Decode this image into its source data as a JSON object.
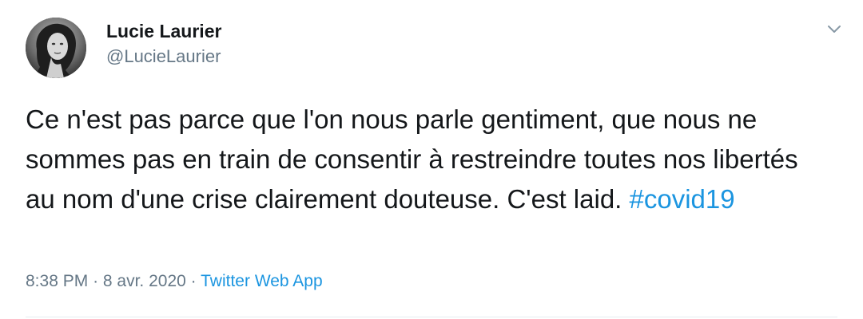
{
  "author": {
    "name": "Lucie Laurier",
    "handle": "@LucieLaurier",
    "avatar_icon": "profile-photo"
  },
  "menu": {
    "icon": "chevron-down-icon"
  },
  "tweet": {
    "text": "Ce n'est pas parce que l'on nous parle gentiment, que nous ne sommes pas en train de consentir à restreindre toutes nos libertés au nom d'une crise clairement douteuse. C'est laid.",
    "hashtag": "#covid19"
  },
  "meta": {
    "time": "8:38 PM",
    "separator": "·",
    "date": "8 avr. 2020",
    "source": "Twitter Web App"
  },
  "colors": {
    "link": "#1b95e0",
    "secondary_text": "#657786",
    "primary_text": "#14171a"
  }
}
